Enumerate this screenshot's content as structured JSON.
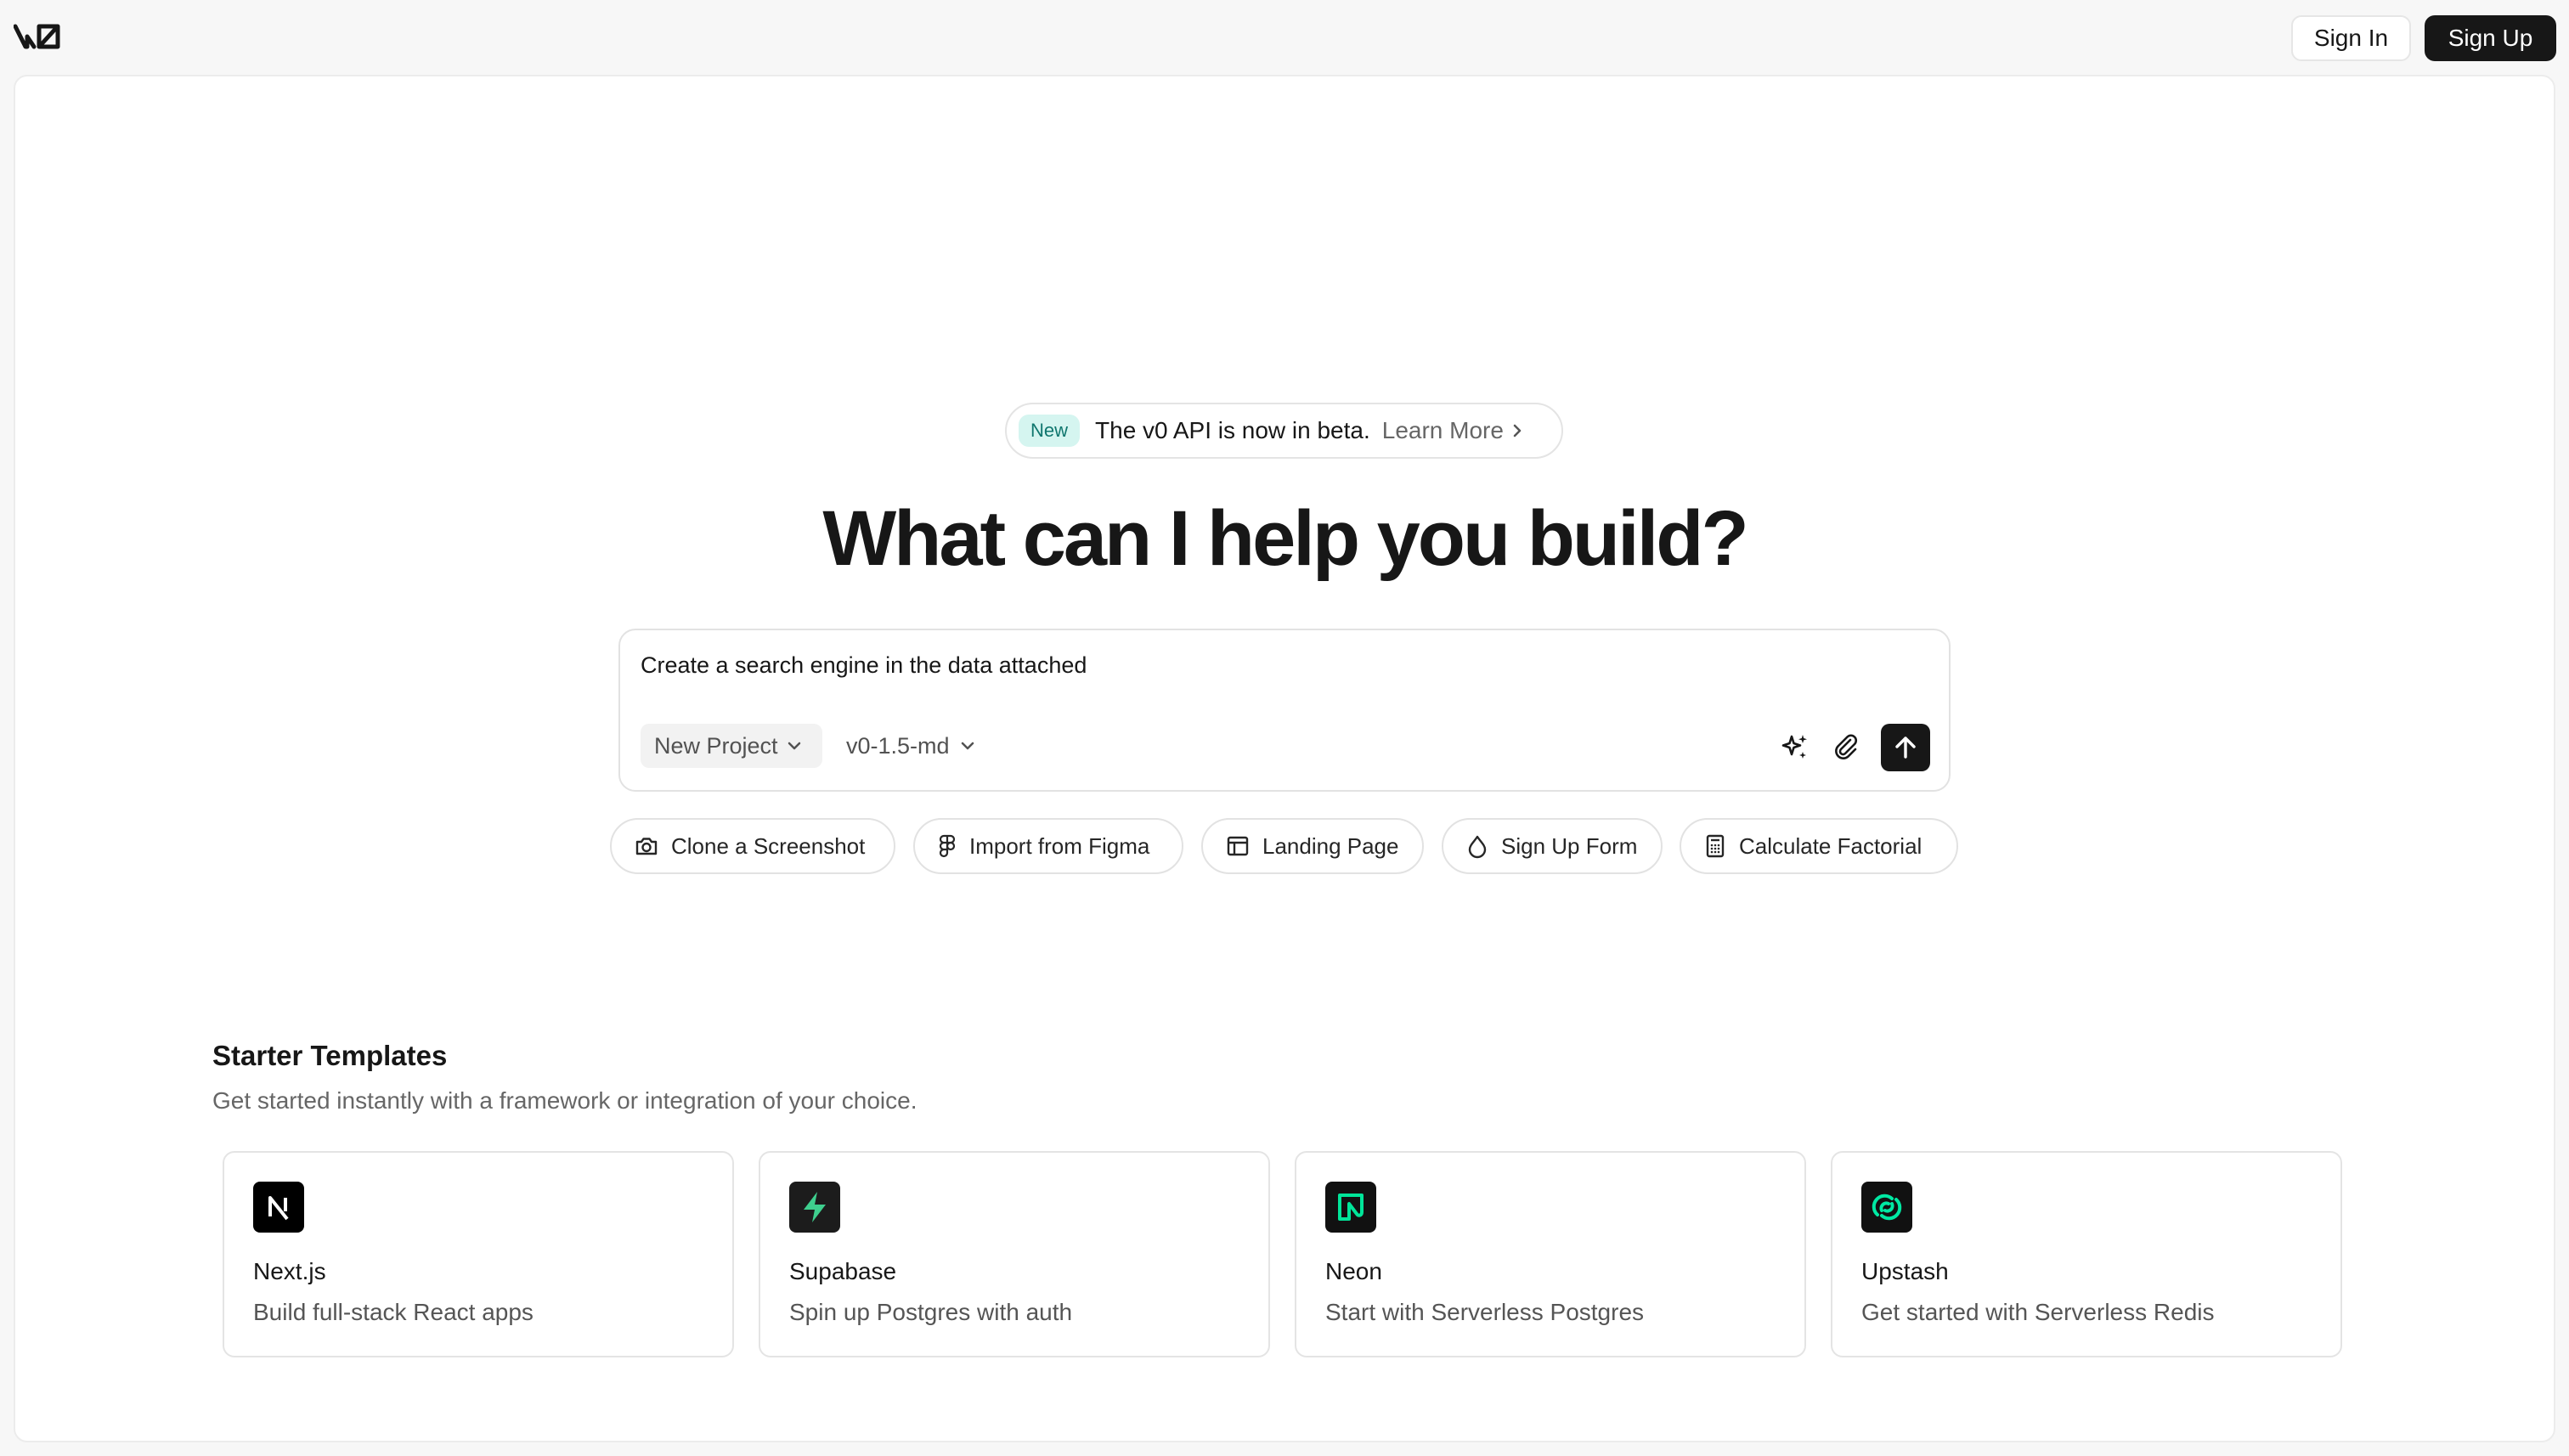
{
  "header": {
    "logo_text": "v0",
    "sign_in_label": "Sign In",
    "sign_up_label": "Sign Up"
  },
  "announcement": {
    "badge": "New",
    "text": "The v0 API is now in beta.",
    "link_label": "Learn More"
  },
  "headline": "What can I help you build?",
  "prompt": {
    "value": "Create a search engine in the data attached",
    "project_label": "New Project",
    "model_label": "v0-1.5-md",
    "enhance_icon": "sparkles-icon",
    "attach_icon": "paperclip-icon",
    "send_icon": "arrow-up-icon"
  },
  "suggestions": [
    {
      "label": "Clone a Screenshot",
      "icon": "camera-icon"
    },
    {
      "label": "Import from Figma",
      "icon": "figma-icon"
    },
    {
      "label": "Landing Page",
      "icon": "layout-icon"
    },
    {
      "label": "Sign Up Form",
      "icon": "droplet-icon"
    },
    {
      "label": "Calculate Factorial",
      "icon": "calculator-icon"
    }
  ],
  "starter_templates": {
    "title": "Starter Templates",
    "subtitle": "Get started instantly with a framework or integration of your choice.",
    "items": [
      {
        "name": "Next.js",
        "description": "Build full-stack React apps",
        "icon": "nextjs-icon"
      },
      {
        "name": "Supabase",
        "description": "Spin up Postgres with auth",
        "icon": "supabase-icon"
      },
      {
        "name": "Neon",
        "description": "Start with Serverless Postgres",
        "icon": "neon-icon"
      },
      {
        "name": "Upstash",
        "description": "Get started with Serverless Redis",
        "icon": "upstash-icon"
      }
    ]
  },
  "colors": {
    "text_primary": "#171717",
    "badge_bg": "#d5f5f0",
    "badge_text": "#0f766e",
    "button_dark": "#171717",
    "supabase_green": "#3ecf8e",
    "neon_green": "#00e599",
    "upstash_green": "#00e9a3"
  }
}
